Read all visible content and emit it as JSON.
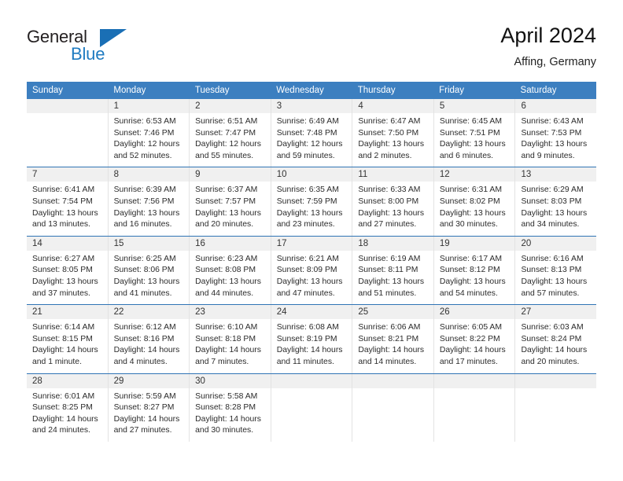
{
  "brand": {
    "word_one": "General",
    "word_two": "Blue",
    "triangle_icon": "brand-triangle-icon"
  },
  "header": {
    "title": "April 2024",
    "location": "Affing, Germany"
  },
  "colors": {
    "header_blue": "#3c7fc0",
    "separator_blue": "#2f74b5",
    "brand_blue": "#1f7bc1",
    "date_band": "#f0f0f0",
    "text": "#2b2b2b"
  },
  "weekdays": [
    "Sunday",
    "Monday",
    "Tuesday",
    "Wednesday",
    "Thursday",
    "Friday",
    "Saturday"
  ],
  "weeks": [
    {
      "days": [
        {
          "num": "",
          "lines": []
        },
        {
          "num": "1",
          "lines": [
            "Sunrise: 6:53 AM",
            "Sunset: 7:46 PM",
            "Daylight: 12 hours",
            "and 52 minutes."
          ]
        },
        {
          "num": "2",
          "lines": [
            "Sunrise: 6:51 AM",
            "Sunset: 7:47 PM",
            "Daylight: 12 hours",
            "and 55 minutes."
          ]
        },
        {
          "num": "3",
          "lines": [
            "Sunrise: 6:49 AM",
            "Sunset: 7:48 PM",
            "Daylight: 12 hours",
            "and 59 minutes."
          ]
        },
        {
          "num": "4",
          "lines": [
            "Sunrise: 6:47 AM",
            "Sunset: 7:50 PM",
            "Daylight: 13 hours",
            "and 2 minutes."
          ]
        },
        {
          "num": "5",
          "lines": [
            "Sunrise: 6:45 AM",
            "Sunset: 7:51 PM",
            "Daylight: 13 hours",
            "and 6 minutes."
          ]
        },
        {
          "num": "6",
          "lines": [
            "Sunrise: 6:43 AM",
            "Sunset: 7:53 PM",
            "Daylight: 13 hours",
            "and 9 minutes."
          ]
        }
      ]
    },
    {
      "days": [
        {
          "num": "7",
          "lines": [
            "Sunrise: 6:41 AM",
            "Sunset: 7:54 PM",
            "Daylight: 13 hours",
            "and 13 minutes."
          ]
        },
        {
          "num": "8",
          "lines": [
            "Sunrise: 6:39 AM",
            "Sunset: 7:56 PM",
            "Daylight: 13 hours",
            "and 16 minutes."
          ]
        },
        {
          "num": "9",
          "lines": [
            "Sunrise: 6:37 AM",
            "Sunset: 7:57 PM",
            "Daylight: 13 hours",
            "and 20 minutes."
          ]
        },
        {
          "num": "10",
          "lines": [
            "Sunrise: 6:35 AM",
            "Sunset: 7:59 PM",
            "Daylight: 13 hours",
            "and 23 minutes."
          ]
        },
        {
          "num": "11",
          "lines": [
            "Sunrise: 6:33 AM",
            "Sunset: 8:00 PM",
            "Daylight: 13 hours",
            "and 27 minutes."
          ]
        },
        {
          "num": "12",
          "lines": [
            "Sunrise: 6:31 AM",
            "Sunset: 8:02 PM",
            "Daylight: 13 hours",
            "and 30 minutes."
          ]
        },
        {
          "num": "13",
          "lines": [
            "Sunrise: 6:29 AM",
            "Sunset: 8:03 PM",
            "Daylight: 13 hours",
            "and 34 minutes."
          ]
        }
      ]
    },
    {
      "days": [
        {
          "num": "14",
          "lines": [
            "Sunrise: 6:27 AM",
            "Sunset: 8:05 PM",
            "Daylight: 13 hours",
            "and 37 minutes."
          ]
        },
        {
          "num": "15",
          "lines": [
            "Sunrise: 6:25 AM",
            "Sunset: 8:06 PM",
            "Daylight: 13 hours",
            "and 41 minutes."
          ]
        },
        {
          "num": "16",
          "lines": [
            "Sunrise: 6:23 AM",
            "Sunset: 8:08 PM",
            "Daylight: 13 hours",
            "and 44 minutes."
          ]
        },
        {
          "num": "17",
          "lines": [
            "Sunrise: 6:21 AM",
            "Sunset: 8:09 PM",
            "Daylight: 13 hours",
            "and 47 minutes."
          ]
        },
        {
          "num": "18",
          "lines": [
            "Sunrise: 6:19 AM",
            "Sunset: 8:11 PM",
            "Daylight: 13 hours",
            "and 51 minutes."
          ]
        },
        {
          "num": "19",
          "lines": [
            "Sunrise: 6:17 AM",
            "Sunset: 8:12 PM",
            "Daylight: 13 hours",
            "and 54 minutes."
          ]
        },
        {
          "num": "20",
          "lines": [
            "Sunrise: 6:16 AM",
            "Sunset: 8:13 PM",
            "Daylight: 13 hours",
            "and 57 minutes."
          ]
        }
      ]
    },
    {
      "days": [
        {
          "num": "21",
          "lines": [
            "Sunrise: 6:14 AM",
            "Sunset: 8:15 PM",
            "Daylight: 14 hours",
            "and 1 minute."
          ]
        },
        {
          "num": "22",
          "lines": [
            "Sunrise: 6:12 AM",
            "Sunset: 8:16 PM",
            "Daylight: 14 hours",
            "and 4 minutes."
          ]
        },
        {
          "num": "23",
          "lines": [
            "Sunrise: 6:10 AM",
            "Sunset: 8:18 PM",
            "Daylight: 14 hours",
            "and 7 minutes."
          ]
        },
        {
          "num": "24",
          "lines": [
            "Sunrise: 6:08 AM",
            "Sunset: 8:19 PM",
            "Daylight: 14 hours",
            "and 11 minutes."
          ]
        },
        {
          "num": "25",
          "lines": [
            "Sunrise: 6:06 AM",
            "Sunset: 8:21 PM",
            "Daylight: 14 hours",
            "and 14 minutes."
          ]
        },
        {
          "num": "26",
          "lines": [
            "Sunrise: 6:05 AM",
            "Sunset: 8:22 PM",
            "Daylight: 14 hours",
            "and 17 minutes."
          ]
        },
        {
          "num": "27",
          "lines": [
            "Sunrise: 6:03 AM",
            "Sunset: 8:24 PM",
            "Daylight: 14 hours",
            "and 20 minutes."
          ]
        }
      ]
    },
    {
      "days": [
        {
          "num": "28",
          "lines": [
            "Sunrise: 6:01 AM",
            "Sunset: 8:25 PM",
            "Daylight: 14 hours",
            "and 24 minutes."
          ]
        },
        {
          "num": "29",
          "lines": [
            "Sunrise: 5:59 AM",
            "Sunset: 8:27 PM",
            "Daylight: 14 hours",
            "and 27 minutes."
          ]
        },
        {
          "num": "30",
          "lines": [
            "Sunrise: 5:58 AM",
            "Sunset: 8:28 PM",
            "Daylight: 14 hours",
            "and 30 minutes."
          ]
        },
        {
          "num": "",
          "lines": []
        },
        {
          "num": "",
          "lines": []
        },
        {
          "num": "",
          "lines": []
        },
        {
          "num": "",
          "lines": []
        }
      ]
    }
  ]
}
